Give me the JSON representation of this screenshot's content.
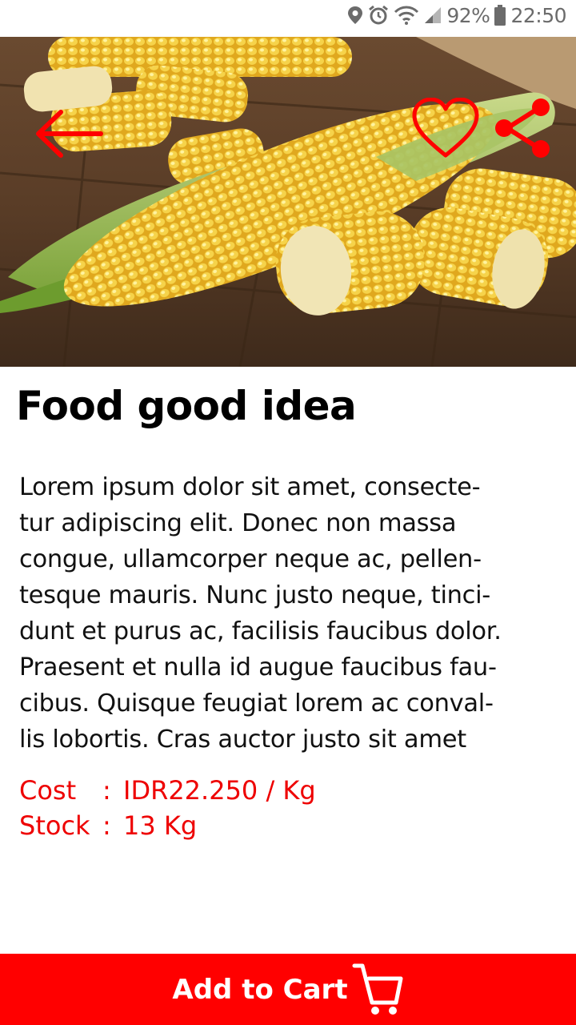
{
  "status_bar": {
    "battery": "92%",
    "time": "22:50",
    "icons": [
      "location-icon",
      "alarm-icon",
      "wifi-icon",
      "signal-icon",
      "battery-icon"
    ]
  },
  "header": {
    "icons": [
      "back-arrow-icon",
      "heart-icon",
      "share-icon"
    ],
    "accent_color": "#ff0000"
  },
  "product": {
    "image": "corn-photo",
    "title": "Food good idea",
    "description_lines": [
      "Lorem ipsum dolor sit amet, consecte-",
      "tur adipiscing elit. Donec non massa",
      "congue, ullamcorper neque ac, pellen-",
      "tesque mauris. Nunc justo neque, tinci-",
      "dunt et purus ac, facilisis faucibus dolor.",
      "Praesent et nulla id augue faucibus fau-",
      "cibus. Quisque feugiat lorem ac conval-",
      "lis lobortis. Cras auctor justo sit amet"
    ],
    "cost_label": "Cost",
    "cost_value": "IDR22.250 / Kg",
    "stock_label": "Stock",
    "stock_value": "13 Kg",
    "separator": ":"
  },
  "footer": {
    "add_to_cart_label": "Add to Cart",
    "icon": "cart-icon",
    "color": "#ff0000"
  }
}
